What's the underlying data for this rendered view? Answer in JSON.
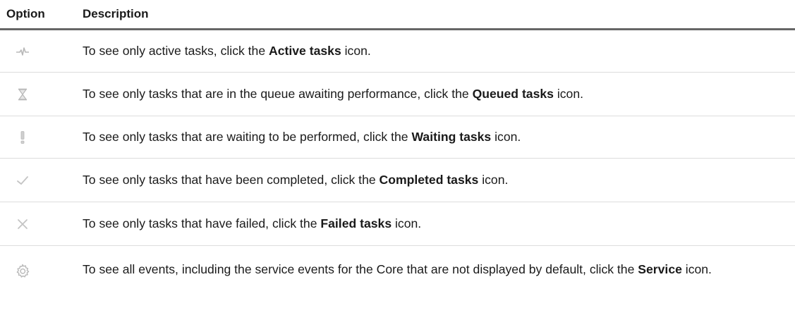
{
  "header": {
    "option": "Option",
    "description": "Description"
  },
  "rows": [
    {
      "icon": "active-tasks-icon",
      "prefix": "To see only active tasks, click the ",
      "bold": "Active tasks",
      "suffix": " icon."
    },
    {
      "icon": "queued-tasks-icon",
      "prefix": "To see only tasks that are in the queue awaiting performance, click the ",
      "bold": "Queued tasks",
      "suffix": " icon."
    },
    {
      "icon": "waiting-tasks-icon",
      "prefix": "To see only tasks that are waiting to be performed, click the ",
      "bold": "Waiting tasks",
      "suffix": " icon."
    },
    {
      "icon": "completed-tasks-icon",
      "prefix": "To see only tasks that have been completed, click the ",
      "bold": "Completed tasks",
      "suffix": " icon."
    },
    {
      "icon": "failed-tasks-icon",
      "prefix": "To see only tasks that have failed, click the ",
      "bold": "Failed tasks",
      "suffix": " icon."
    },
    {
      "icon": "service-icon",
      "prefix": "To see all events, including the service events for the Core that are not displayed by default, click the ",
      "bold": "Service",
      "suffix": " icon."
    }
  ],
  "colors": {
    "icon_gray": "#b8b8b8",
    "header_rule": "#666666",
    "row_rule": "#dddddd"
  }
}
